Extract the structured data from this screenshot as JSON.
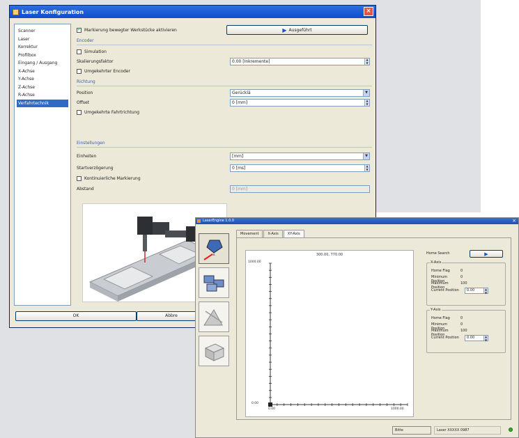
{
  "config": {
    "title": "Laser Konfiguration",
    "nav": [
      "Scanner",
      "Laser",
      "Korrektur",
      "Profilbox",
      "Eingang / Ausgang",
      "X-Achse",
      "Y-Achse",
      "Z-Achse",
      "R-Achse",
      "Verfahrtechnik"
    ],
    "nav_selected": 9,
    "marking_checkbox": "Markierung bewegter Werkstücke aktivieren",
    "run_button": "Ausgeführt",
    "section_encoder": "Encoder",
    "simulation": "Simulation",
    "encoder_factor_label": "Skalierungsfaktor",
    "encoder_factor_value": "0.00 [Inkremente]",
    "inverse_encoder": "Umgekehrter Encoder",
    "section_position": "Richtung",
    "position_label": "Position",
    "position_value": "Gerücklä",
    "offset_label": "Offset",
    "offset_value": "0 [mm]",
    "inverse_feed": "Umgekehrte Fahrtrichtung",
    "section_settings": "Einstellungen",
    "unit_label": "Einheiten",
    "unit_value": "[mm]",
    "start_delay_label": "Startverzögerung",
    "start_delay_value": "0 [ms]",
    "continuous_marking": "Kontinuierliche Markierung",
    "distance_label": "Abstand",
    "distance_value": "0 [mm]",
    "ok_button": "OK",
    "cancel_button": "Abbre"
  },
  "app": {
    "title": "LaserEngine 1.0.0",
    "tabs": [
      "Movement",
      "X-Axis",
      "XY-Axis"
    ],
    "tab_selected": 2,
    "plot_coord": "300.00, 770.00",
    "plot_y_max": "1000.00",
    "plot_y_min": "0.00",
    "plot_x_min": "0.00",
    "plot_x_max": "1000.00",
    "home_search": "Home Search",
    "x_axis": {
      "title": "X-Axis",
      "rows": [
        {
          "label": "Home Flag",
          "value": "0"
        },
        {
          "label": "Minimum Position",
          "value": "0"
        },
        {
          "label": "Maximum Position",
          "value": "100"
        }
      ],
      "current_label": "Current Position",
      "current_value": "0.00"
    },
    "y_axis": {
      "title": "Y-Axis",
      "rows": [
        {
          "label": "Home Flag",
          "value": "0"
        },
        {
          "label": "Minimum Position",
          "value": "0"
        },
        {
          "label": "Maximum Position",
          "value": "100"
        }
      ],
      "current_label": "Current Position",
      "current_value": "0.00"
    },
    "status_left": "Bitte",
    "status_right": "Laser XXXXX 0987",
    "status_led_color": "#2fae2f"
  }
}
